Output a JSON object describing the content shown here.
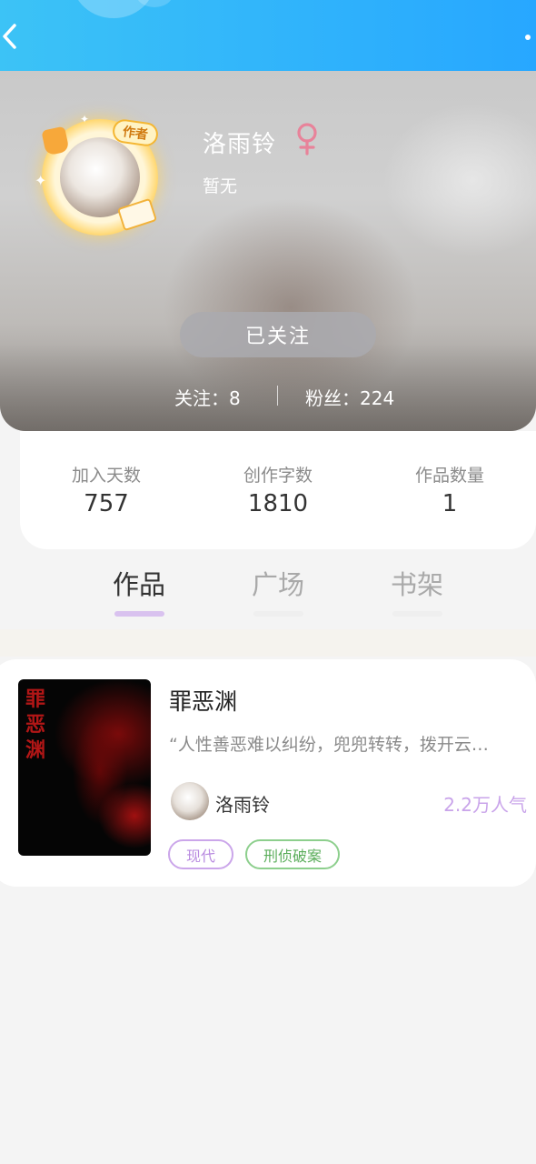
{
  "topbar": {
    "back_icon": "chevron-left-icon",
    "more_icon": "more-dot-icon",
    "color": "#27a7ff"
  },
  "profile": {
    "avatar_badge": "作者",
    "name": "洛雨铃",
    "gender_icon": "female-icon",
    "gender_color": "#e8839a",
    "bio": "暂无",
    "follow_button": "已关注",
    "following_text": "关注：8",
    "fans_text": "粉丝：224"
  },
  "stats": [
    {
      "label": "加入天数",
      "value": "757"
    },
    {
      "label": "创作字数",
      "value": "1810"
    },
    {
      "label": "作品数量",
      "value": "1"
    }
  ],
  "tabs": [
    {
      "label": "作品",
      "active": true
    },
    {
      "label": "广场",
      "active": false
    },
    {
      "label": "书架",
      "active": false
    }
  ],
  "works": [
    {
      "cover_text": "罪恶渊",
      "title": "罪恶渊",
      "description": "“人性善恶难以纠纷，兜兜转转，拨开云…",
      "author": "洛雨铃",
      "popularity": "2.2万人气",
      "tags": [
        "现代",
        "刑侦破案"
      ]
    }
  ]
}
